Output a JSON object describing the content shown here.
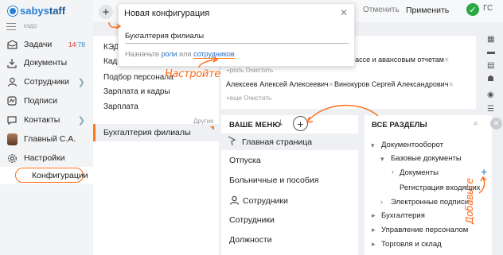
{
  "app": {
    "logo_a": "sabys",
    "logo_b": "taff",
    "sub_label": "кэдо"
  },
  "sidebar": {
    "items": [
      {
        "label": "Задачи",
        "badge_red": "14",
        "badge_sep": "|",
        "badge_blue": "78"
      },
      {
        "label": "Документы"
      },
      {
        "label": "Сотрудники",
        "chevron": "❯"
      },
      {
        "label": "Подписи"
      },
      {
        "label": "Контакты",
        "chevron": "❯"
      },
      {
        "label": "Главный С.А."
      },
      {
        "label": "Настройки"
      },
      {
        "label": "Конфигурации"
      }
    ]
  },
  "topbar": {
    "plus": "+",
    "cancel": "Отменить",
    "apply": "Применить",
    "check": "✓",
    "user": "ГС"
  },
  "popup": {
    "title": "Новая конфигурация",
    "close": "✕",
    "name_value": "Бухгалтерия филиалы",
    "hint_start": "Назначьте",
    "hint_roles": "роли",
    "hint_or": "или",
    "hint_employees": "сотрудников"
  },
  "midlist": {
    "items": [
      "КЭД",
      "Кадр",
      "Подбор персонала",
      "Зарплата и кадры",
      "Зарплата"
    ],
    "group_label": "Другие",
    "selected": "Бухгалтерия филиалы"
  },
  "rightpanel": {
    "line1": "кассе и авансовым отчетам",
    "line1_x": "✕",
    "line2_a": "+роль",
    "line2_b": "Очистить",
    "person1": "Алексеев Алексей Алексеевич",
    "person2": "Винокуров Сергей Александрович",
    "x": "✕",
    "line4_a": "+еще",
    "line4_b": "Очистить"
  },
  "menu_panel": {
    "title": "ВАШЕ МЕНЮ",
    "download_icon": "⤓",
    "add": "+",
    "items": [
      "Главная страница",
      "Отпуска",
      "Больничные и пособия",
      "Сотрудники",
      "Сотрудники",
      "Должности"
    ]
  },
  "all_panel": {
    "title": "ВСЕ РАЗДЕЛЫ",
    "search_icon": "⌕",
    "close": "✕",
    "items": [
      "Документооборот",
      "Базовые документы",
      "Документы",
      "Регистрация входящих",
      "Электронные подписи",
      "Бухгалтерия",
      "Управление персоналом",
      "Торговля и склад"
    ],
    "add": "+"
  },
  "annotations": {
    "setup": "Настройте",
    "add": "Добавьте"
  },
  "colors": {
    "accent": "#ff6a1a",
    "link": "#2a6fc0",
    "apply_green": "#2aa844"
  }
}
